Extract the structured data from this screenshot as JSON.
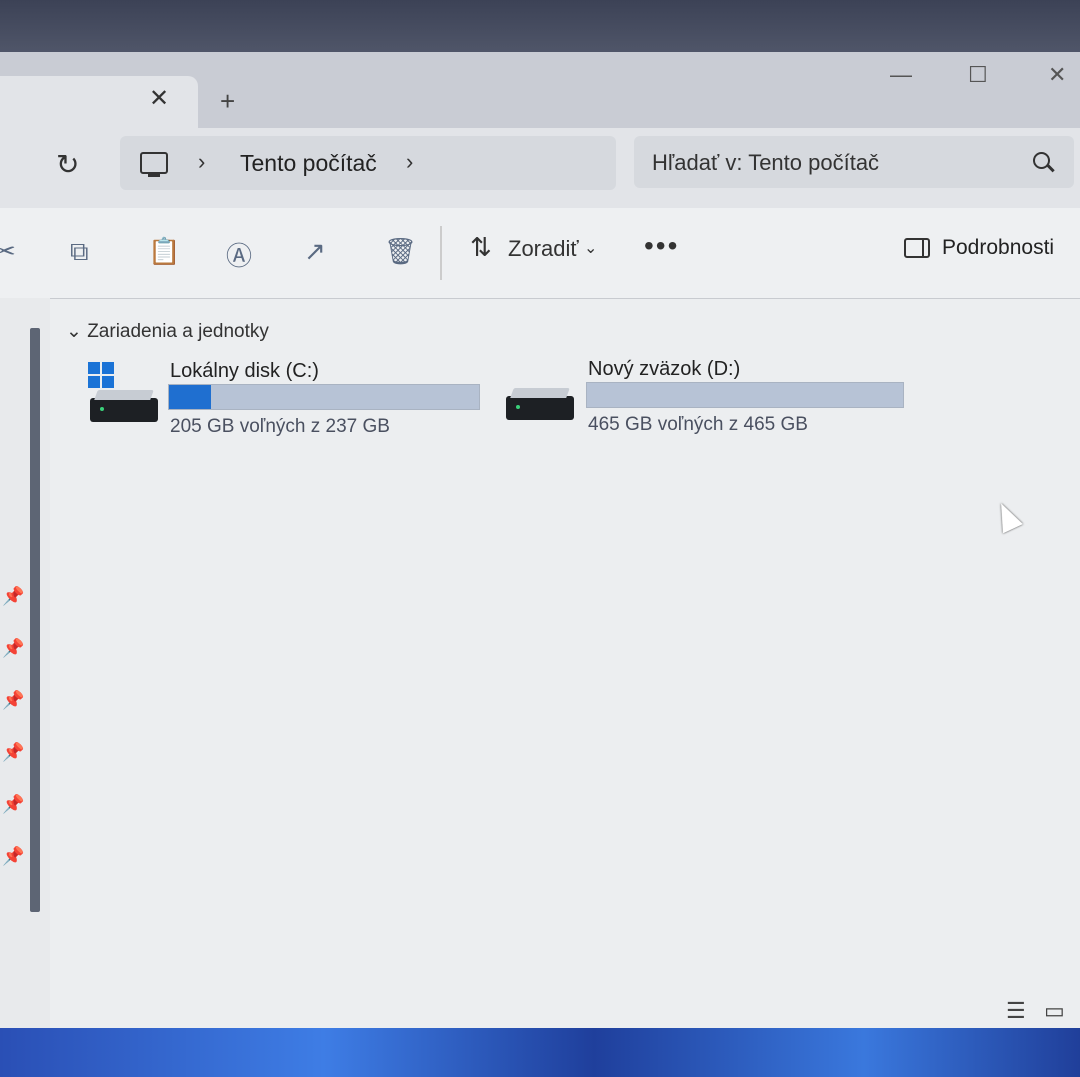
{
  "window": {
    "tab_close": "✕",
    "tab_add": "+",
    "controls": {
      "minimize": "—",
      "maximize": "☐",
      "close": "✕"
    }
  },
  "address": {
    "refresh": "↻",
    "breadcrumb": "Tento počítač",
    "search_placeholder": "Hľadať v: Tento počítač"
  },
  "toolbar": {
    "sort_label": "Zoradiť",
    "sort_chevron": "⌄",
    "more_label": "•••",
    "details_label": "Podrobnosti"
  },
  "content": {
    "group_header": "Zariadenia a jednotky",
    "drives": [
      {
        "name": "Lokálny disk (C:)",
        "free_text": "205 GB voľných z 237 GB",
        "used_fraction": 0.135
      },
      {
        "name": "Nový zväzok (D:)",
        "free_text": "465 GB voľných z 465 GB",
        "used_fraction": 0.0
      }
    ]
  },
  "colors": {
    "accent": "#1f6fd0",
    "bar_background": "#b7c3d6"
  }
}
